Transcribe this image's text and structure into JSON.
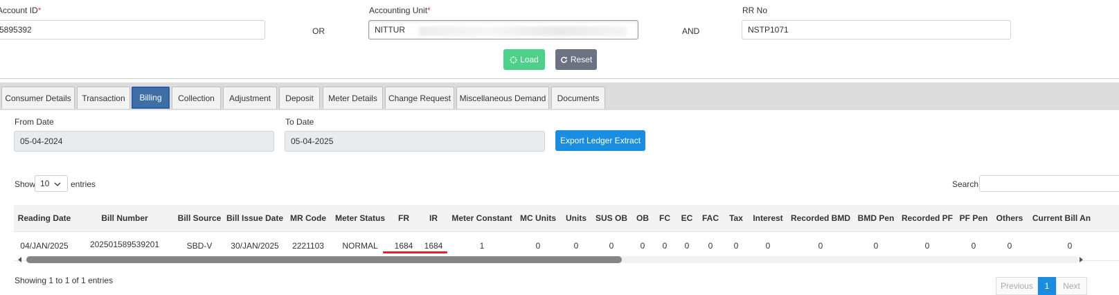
{
  "form": {
    "account_id_label": "Account ID",
    "account_id_value": "5895392",
    "or_label": "OR",
    "accounting_unit_label": "Accounting Unit",
    "accounting_unit_value": "NITTUR",
    "and_label": "AND",
    "rr_no_label": "RR No",
    "rr_no_value": "NSTP1071",
    "required_mark": "*",
    "load_label": "Load",
    "reset_label": "Reset"
  },
  "tabs": [
    {
      "label": "Consumer Details"
    },
    {
      "label": "Transaction"
    },
    {
      "label": "Billing"
    },
    {
      "label": "Collection"
    },
    {
      "label": "Adjustment"
    },
    {
      "label": "Deposit"
    },
    {
      "label": "Meter Details"
    },
    {
      "label": "Change Request"
    },
    {
      "label": "Miscellaneous Demand"
    },
    {
      "label": "Documents"
    }
  ],
  "active_tab": "Billing",
  "billing": {
    "from_date_label": "From Date",
    "from_date_value": "05-04-2024",
    "to_date_label": "To Date",
    "to_date_value": "05-04-2025",
    "export_label": "Export Ledger Extract"
  },
  "table": {
    "show_label": "Show",
    "entries_value": "10",
    "entries_label": "entries",
    "search_label": "Search:",
    "columns": [
      "Reading Date",
      "Bill Number",
      "Bill Source",
      "Bill Issue Date",
      "MR Code",
      "Meter Status",
      "FR",
      "IR",
      "Meter Constant",
      "MC Units",
      "Units",
      "SUS OB",
      "OB",
      "FC",
      "EC",
      "FAC",
      "Tax",
      "Interest",
      "Recorded BMD",
      "BMD Pen",
      "Recorded PF",
      "PF Pen",
      "Others",
      "Current Bill An"
    ],
    "rows": [
      [
        "04/JAN/2025",
        "202501589539201",
        "SBD-V",
        "30/JAN/2025",
        "2221103",
        "NORMAL",
        "1684",
        "1684",
        "1",
        "0",
        "0",
        "0",
        "0",
        "0",
        "0",
        "0",
        "0",
        "0",
        "0",
        "0",
        "0",
        "0",
        "0",
        "0"
      ]
    ],
    "info": "Showing 1 to 1 of 1 entries",
    "pagination": {
      "previous": "Previous",
      "page": "1",
      "next": "Next"
    }
  },
  "colors": {
    "load_button": "#4cd08a",
    "reset_button": "#6c7281",
    "export_button": "#1a8de0",
    "active_tab": "#3d6fa6",
    "annotation_underline": "#e0202a"
  },
  "icons": {
    "load": "spinner-icon",
    "reset": "refresh-icon",
    "dropdown": "chevron-down-icon"
  }
}
